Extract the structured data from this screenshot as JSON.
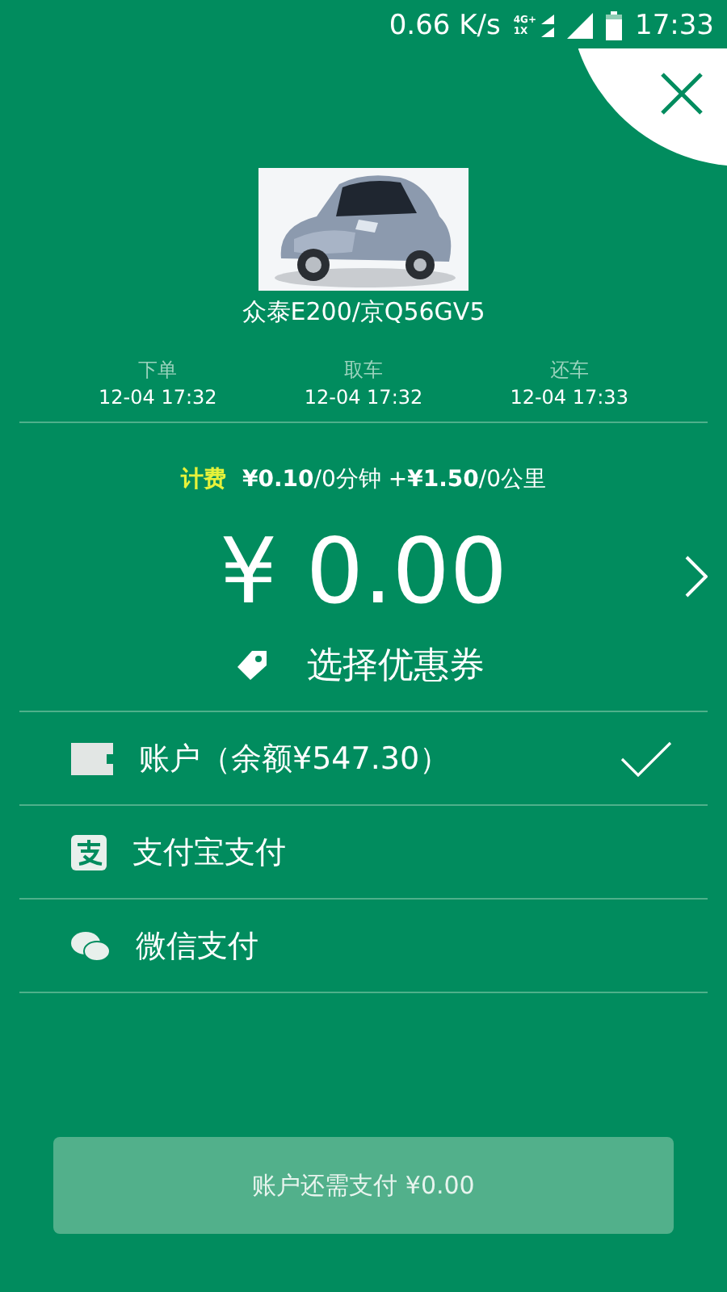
{
  "status_bar": {
    "speed": "0.66 K/s",
    "network_top": "4G+",
    "network_bottom": "1X",
    "time": "17:33"
  },
  "car": {
    "name": "众泰E200/京Q56GV5"
  },
  "timeline": [
    {
      "label": "下单",
      "time": "12-04 17:32"
    },
    {
      "label": "取车",
      "time": "12-04 17:32"
    },
    {
      "label": "还车",
      "time": "12-04 17:33"
    }
  ],
  "fee": {
    "label": "计费",
    "detail": "**¥0.10**/0分钟 +**¥1.50**/0公里"
  },
  "amount": "¥ 0.00",
  "coupon": "选择优惠券",
  "payment_methods": [
    {
      "kind": "account",
      "label": "账户（余额¥547.30）",
      "selected": true
    },
    {
      "kind": "alipay",
      "label": "支付宝支付",
      "selected": false
    },
    {
      "kind": "wechat",
      "label": "微信支付",
      "selected": false
    }
  ],
  "pay_button": "账户还需支付 ¥0.00"
}
